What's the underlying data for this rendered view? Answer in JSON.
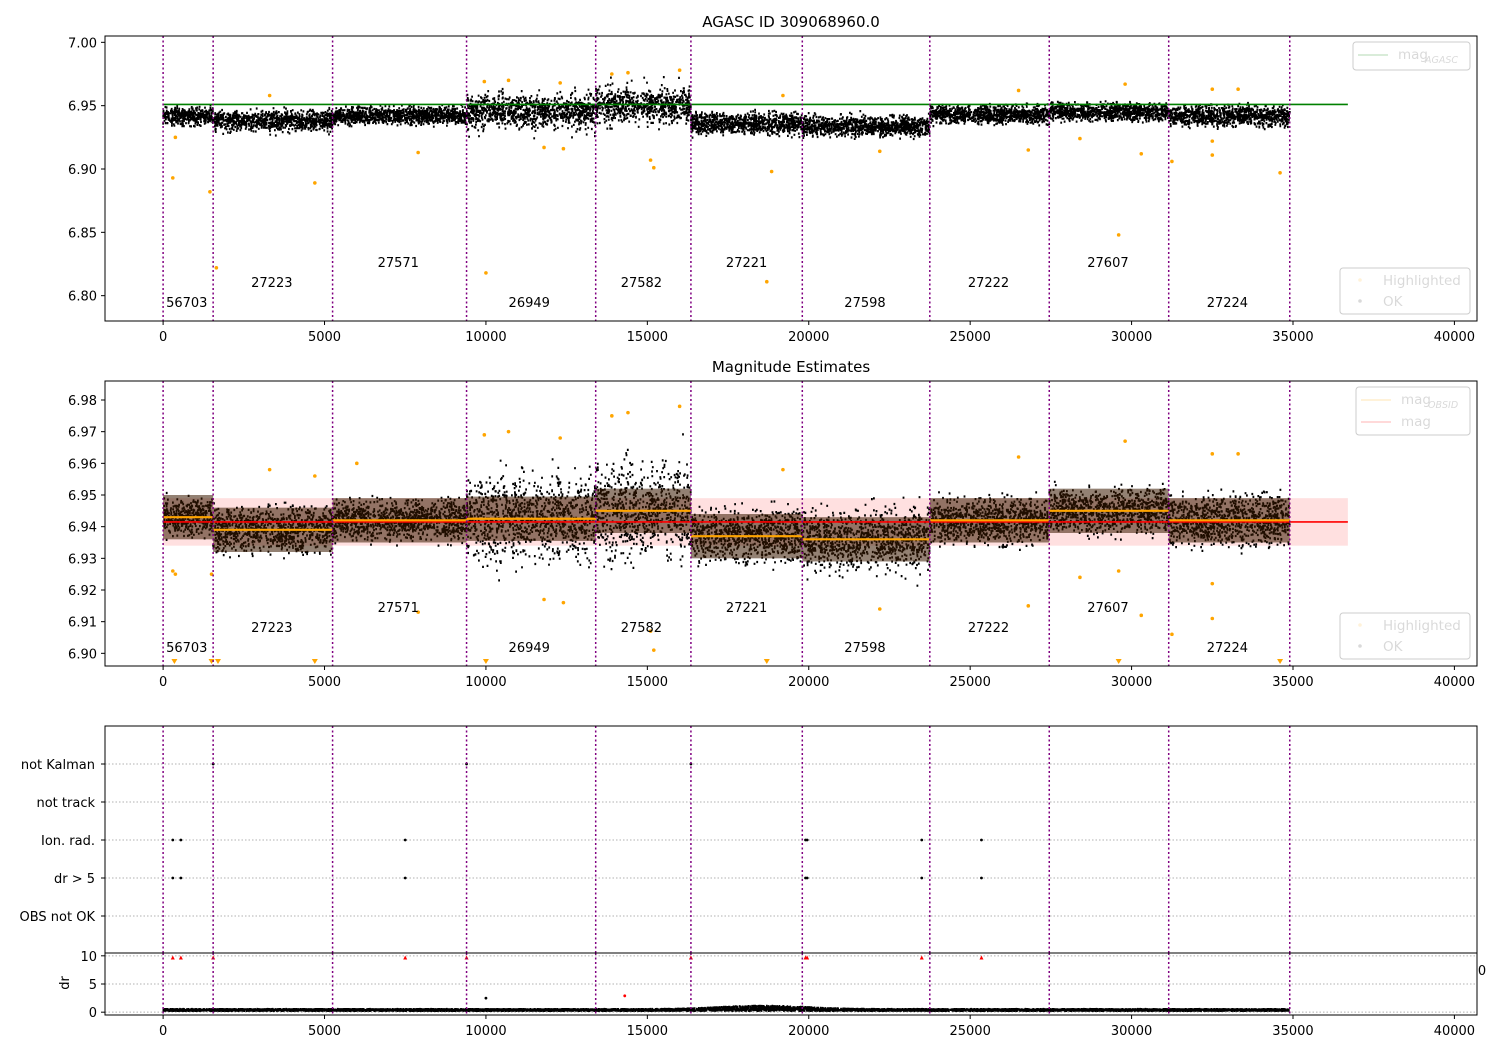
{
  "chart_data": [
    {
      "type": "scatter",
      "title": "AGASC ID 309068960.0",
      "xlim": [
        -1800,
        40700
      ],
      "ylim": [
        6.78,
        7.005
      ],
      "xticks": [
        "0",
        "5000",
        "10000",
        "15000",
        "20000",
        "25000",
        "30000",
        "35000",
        "40000"
      ],
      "yticks": [
        "6.80",
        "6.85",
        "6.90",
        "6.95",
        "7.00"
      ],
      "mag_agasc": 6.951,
      "mag_agasc_xrange": [
        0,
        36700
      ],
      "legend_top": {
        "placement": "top-right",
        "entries": [
          {
            "label": "mag",
            "sub": "AGASC",
            "color": "#008000"
          }
        ]
      },
      "legend_bottom": {
        "placement": "bottom-right",
        "entries": [
          {
            "label": "Highlighted",
            "color": "#ffa500"
          },
          {
            "label": "OK",
            "color": "#000000"
          }
        ]
      },
      "obs_boundaries": [
        0,
        1550,
        5250,
        9400,
        13400,
        16350,
        19800,
        23750,
        27450,
        31150,
        34900
      ],
      "obsids": [
        "56703",
        "27223",
        "27571",
        "26949",
        "27582",
        "27221",
        "27598",
        "27222",
        "27607",
        "27224"
      ],
      "ok_band": {
        "center": [
          6.942,
          6.938,
          6.942,
          6.945,
          6.95,
          6.936,
          6.934,
          6.943,
          6.945,
          6.942
        ],
        "half_width": [
          0.01,
          0.012,
          0.01,
          0.014,
          0.016,
          0.012,
          0.012,
          0.01,
          0.01,
          0.012
        ]
      },
      "highlighted": [
        [
          300,
          6.893
        ],
        [
          380,
          6.925
        ],
        [
          1450,
          6.882
        ],
        [
          1650,
          6.822
        ],
        [
          4700,
          6.889
        ],
        [
          7900,
          6.913
        ],
        [
          10000,
          6.818
        ],
        [
          11800,
          6.917
        ],
        [
          12400,
          6.916
        ],
        [
          15100,
          6.907
        ],
        [
          15200,
          6.901
        ],
        [
          18700,
          6.811
        ],
        [
          18850,
          6.898
        ],
        [
          22200,
          6.914
        ],
        [
          26800,
          6.915
        ],
        [
          28400,
          6.924
        ],
        [
          29600,
          6.848
        ],
        [
          30300,
          6.912
        ],
        [
          31250,
          6.906
        ],
        [
          32500,
          6.911
        ],
        [
          32500,
          6.922
        ],
        [
          34600,
          6.897
        ],
        [
          3300,
          6.958
        ],
        [
          9950,
          6.969
        ],
        [
          10700,
          6.97
        ],
        [
          12300,
          6.968
        ],
        [
          13900,
          6.975
        ],
        [
          14400,
          6.976
        ],
        [
          16000,
          6.978
        ],
        [
          19200,
          6.958
        ],
        [
          26500,
          6.962
        ],
        [
          29800,
          6.967
        ],
        [
          32500,
          6.963
        ],
        [
          33300,
          6.963
        ]
      ]
    },
    {
      "type": "scatter",
      "title": "Magnitude Estimates",
      "xlim": [
        -1800,
        40700
      ],
      "ylim": [
        6.896,
        6.986
      ],
      "xticks": [
        "0",
        "5000",
        "10000",
        "15000",
        "20000",
        "25000",
        "30000",
        "35000",
        "40000"
      ],
      "yticks": [
        "6.90",
        "6.91",
        "6.92",
        "6.93",
        "6.94",
        "6.95",
        "6.96",
        "6.97",
        "6.98"
      ],
      "mag": 6.9415,
      "mag_band": [
        6.934,
        6.949
      ],
      "mag_xrange": [
        0,
        36700
      ],
      "mag_obsid": [
        6.943,
        6.939,
        6.942,
        6.9425,
        6.945,
        6.937,
        6.936,
        6.942,
        6.945,
        6.942
      ],
      "legend_top": {
        "placement": "top-right",
        "entries": [
          {
            "label": "mag",
            "sub": "OBSID",
            "color": "#ffa500"
          },
          {
            "label": "mag",
            "color": "#ff0000"
          }
        ]
      },
      "legend_bottom": {
        "placement": "bottom-right",
        "entries": [
          {
            "label": "Highlighted",
            "color": "#ffa500"
          },
          {
            "label": "OK",
            "color": "#000000"
          }
        ]
      },
      "highlighted": [
        [
          300,
          6.926
        ],
        [
          380,
          6.925
        ],
        [
          1500,
          6.925
        ],
        [
          26800,
          6.915
        ],
        [
          28400,
          6.924
        ],
        [
          29600,
          6.926
        ],
        [
          30300,
          6.912
        ],
        [
          31250,
          6.906
        ],
        [
          32500,
          6.911
        ],
        [
          32500,
          6.922
        ],
        [
          15100,
          6.907
        ],
        [
          15200,
          6.901
        ],
        [
          11800,
          6.917
        ],
        [
          12400,
          6.916
        ],
        [
          7900,
          6.913
        ],
        [
          22200,
          6.914
        ],
        [
          3300,
          6.958
        ],
        [
          4700,
          6.956
        ],
        [
          6000,
          6.96
        ],
        [
          9950,
          6.969
        ],
        [
          10700,
          6.97
        ],
        [
          12300,
          6.968
        ],
        [
          13900,
          6.975
        ],
        [
          14400,
          6.976
        ],
        [
          16000,
          6.978
        ],
        [
          19200,
          6.958
        ],
        [
          26500,
          6.962
        ],
        [
          29800,
          6.967
        ],
        [
          32500,
          6.963
        ],
        [
          33300,
          6.963
        ]
      ],
      "below_range_markers": [
        350,
        1500,
        1700,
        4700,
        10000,
        18700,
        29600,
        34600
      ]
    },
    {
      "type": "scatter",
      "title": "",
      "xlim": [
        -1800,
        40700
      ],
      "flag_labels": [
        "not Kalman",
        "not track",
        "Ion. rad.",
        "dr > 5",
        "OBS not OK"
      ],
      "flag_points": {
        "not Kalman": [
          1550,
          9400,
          16350
        ],
        "not track": [],
        "Ion. rad.": [
          300,
          550,
          7500,
          19900,
          19950,
          23500,
          25350
        ],
        "dr > 5": [
          300,
          550,
          7500,
          19900,
          19950,
          23500,
          25350
        ],
        "OBS not OK": []
      }
    },
    {
      "type": "scatter",
      "title": "",
      "ylabel": "dr",
      "xlim": [
        -1800,
        40700
      ],
      "ylim": [
        -0.5,
        10.5
      ],
      "xticks": [
        "0",
        "5000",
        "10000",
        "15000",
        "20000",
        "25000",
        "30000",
        "35000",
        "40000"
      ],
      "yticks": [
        "0",
        "5",
        "10"
      ],
      "clipped_marker_value": 9.7,
      "clipped_marker_x": [
        300,
        550,
        1550,
        7500,
        9400,
        16350,
        19900,
        19950,
        23500,
        25350
      ],
      "outliers": [
        [
          10000,
          2.5
        ],
        [
          14300,
          2.9
        ]
      ],
      "baseline": {
        "typical": 0.4,
        "jitter": 0.3,
        "hump_center": 18600,
        "hump_height": 0.6
      },
      "cut_off_tick_label": "0"
    }
  ]
}
